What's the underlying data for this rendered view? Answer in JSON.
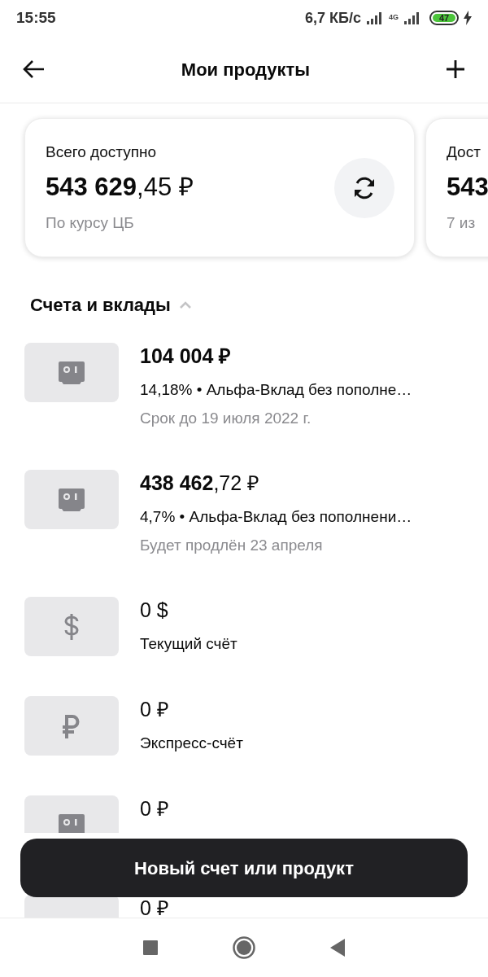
{
  "status_bar": {
    "time": "15:55",
    "speed": "6,7 КБ/с",
    "network": "4G",
    "battery": "47"
  },
  "header": {
    "title": "Мои продукты"
  },
  "cards": [
    {
      "kind": "summary",
      "label": "Всего доступно",
      "amount": "**543 629**,45 ₽",
      "note": "По курсу ЦБ"
    },
    {
      "label": "Дост",
      "amount": "**543**",
      "note": "7 из"
    }
  ],
  "section": {
    "title": "Счета и вклады",
    "expanded": true
  },
  "products": [
    {
      "kind": "deposit",
      "amount": "104 004 ₽",
      "all_bold": true,
      "subtitle": "14,18% • Альфа-Вклад без пополне…",
      "note": "Срок до 19 июля 2022 г."
    },
    {
      "kind": "deposit",
      "amount": "**438 462**,72 ₽",
      "all_bold": false,
      "subtitle": "4,7% • Альфа-Вклад без пополнени…",
      "note": "Будет продлён 23 апреля"
    },
    {
      "kind": "usd",
      "amount": "0 $",
      "all_bold": false,
      "subtitle": "Текущий счёт"
    },
    {
      "kind": "rub",
      "amount": "0 ₽",
      "all_bold": false,
      "subtitle": "Экспресс-счёт"
    },
    {
      "kind": "deposit",
      "amount": "0 ₽",
      "all_bold": false
    },
    {
      "amount": "0 ₽",
      "all_bold": false
    }
  ],
  "action_button": {
    "label": "Новый счет или продукт"
  }
}
